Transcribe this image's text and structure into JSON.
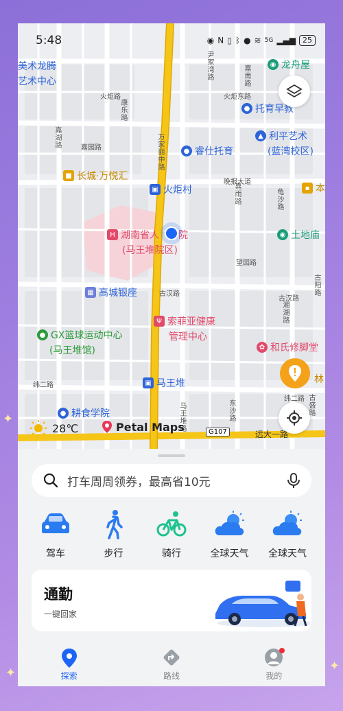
{
  "status_bar": {
    "time": "5:48",
    "network": "5G",
    "battery": "25"
  },
  "map": {
    "pois": [
      {
        "name": "美术龙腾",
        "color": "#2e64d8"
      },
      {
        "name": "艺术中心",
        "color": "#2e64d8"
      },
      {
        "name": "龙舟屋",
        "color": "#1a9c7a"
      },
      {
        "name": "托育早教",
        "color": "#2e64d8"
      },
      {
        "name": "利平艺术",
        "color": "#2e64d8"
      },
      {
        "name": "(蓝湾校区)",
        "color": "#2e64d8"
      },
      {
        "name": "睿仕托育",
        "color": "#2e64d8"
      },
      {
        "name": "长城·万悦汇",
        "color": "#c98a00"
      },
      {
        "name": "火炬村",
        "color": "#2e64d8"
      },
      {
        "name": "本",
        "color": "#c98a00"
      },
      {
        "name": "湖南省人",
        "color": "#e24a6a"
      },
      {
        "name": "院",
        "color": "#e24a6a"
      },
      {
        "name": "(马王堆院区)",
        "color": "#e24a6a"
      },
      {
        "name": "土地庙",
        "color": "#1a9c7a"
      },
      {
        "name": "高城银座",
        "color": "#2e64d8"
      },
      {
        "name": "索菲亚健康",
        "color": "#e24a6a"
      },
      {
        "name": "管理中心",
        "color": "#e24a6a"
      },
      {
        "name": "GX篮球运动中心",
        "color": "#2e9a3a"
      },
      {
        "name": "(马王堆馆)",
        "color": "#2e9a3a"
      },
      {
        "name": "和氏修脚堂",
        "color": "#e24a6a"
      },
      {
        "name": "马王堆",
        "color": "#2e64d8"
      },
      {
        "name": "林",
        "color": "#c98a00"
      },
      {
        "name": "耕食学院",
        "color": "#2e64d8"
      }
    ],
    "roads": [
      "火炬东路",
      "火炬路",
      "嘉园路",
      "东沙路",
      "万家丽中路",
      "晚报大道",
      "嘉雨路",
      "龟沙路",
      "古汉路",
      "马王堆路",
      "远大一路",
      "纬二路",
      "康乐路",
      "尹家湾路",
      "嘉南路",
      "望园路",
      "古阳路",
      "湘湖路",
      "嘉湖路",
      "古盛路",
      "古汉路"
    ],
    "road_shields": [
      "G107",
      "G107"
    ],
    "weather": {
      "temperature": "28℃",
      "icon": "sun-icon"
    },
    "brand": "Petal Maps"
  },
  "sheet": {
    "search_placeholder": "打车周周领券，最高省10元",
    "quick_actions": [
      {
        "label": "驾车",
        "icon": "car-icon"
      },
      {
        "label": "步行",
        "icon": "walk-icon"
      },
      {
        "label": "骑行",
        "icon": "bike-icon"
      },
      {
        "label": "全球天气",
        "icon": "weather-icon"
      },
      {
        "label": "全球天气",
        "icon": "weather-icon"
      }
    ],
    "commute": {
      "title": "通勤",
      "subtitle": "一键回家"
    }
  },
  "tabs": [
    {
      "label": "探索",
      "icon": "explore-pin-icon",
      "active": true
    },
    {
      "label": "路线",
      "icon": "route-icon",
      "active": false
    },
    {
      "label": "我的",
      "icon": "profile-icon",
      "active": false
    }
  ],
  "colors": {
    "accent": "#1d66f5",
    "highway": "#f5c518"
  }
}
